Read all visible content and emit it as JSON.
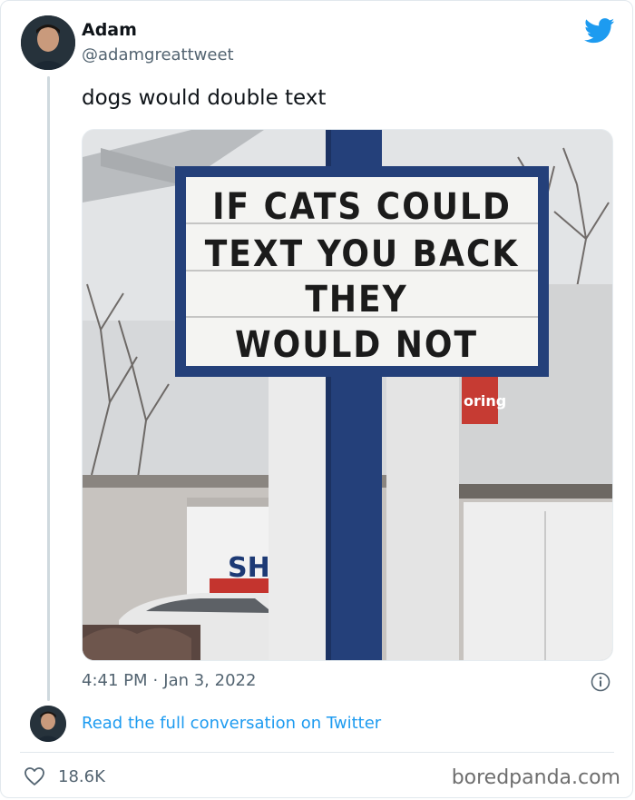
{
  "author": {
    "name": "Adam",
    "handle": "@adamgreattweet",
    "avatar_icon": "user-avatar"
  },
  "tweet": {
    "text": "dogs would double text",
    "image_sign": {
      "line1": "IF CATS COULD",
      "line2": "TEXT YOU BACK",
      "line3": "THEY",
      "line4": "WOULD NOT"
    },
    "background_signs": {
      "store_sign": "oring",
      "truck_text": "SH"
    },
    "time": "4:41 PM",
    "separator": "·",
    "date": "Jan 3, 2022"
  },
  "footer": {
    "read_link": "Read the full conversation on Twitter",
    "likes": "18.6K",
    "watermark": "boredpanda.com"
  },
  "icons": {
    "brand": "twitter-bird-icon",
    "info": "info-icon",
    "like": "heart-icon"
  },
  "colors": {
    "twitter_blue": "#1d9bf0",
    "secondary_text": "#536471",
    "sign_frame": "#24407a"
  }
}
